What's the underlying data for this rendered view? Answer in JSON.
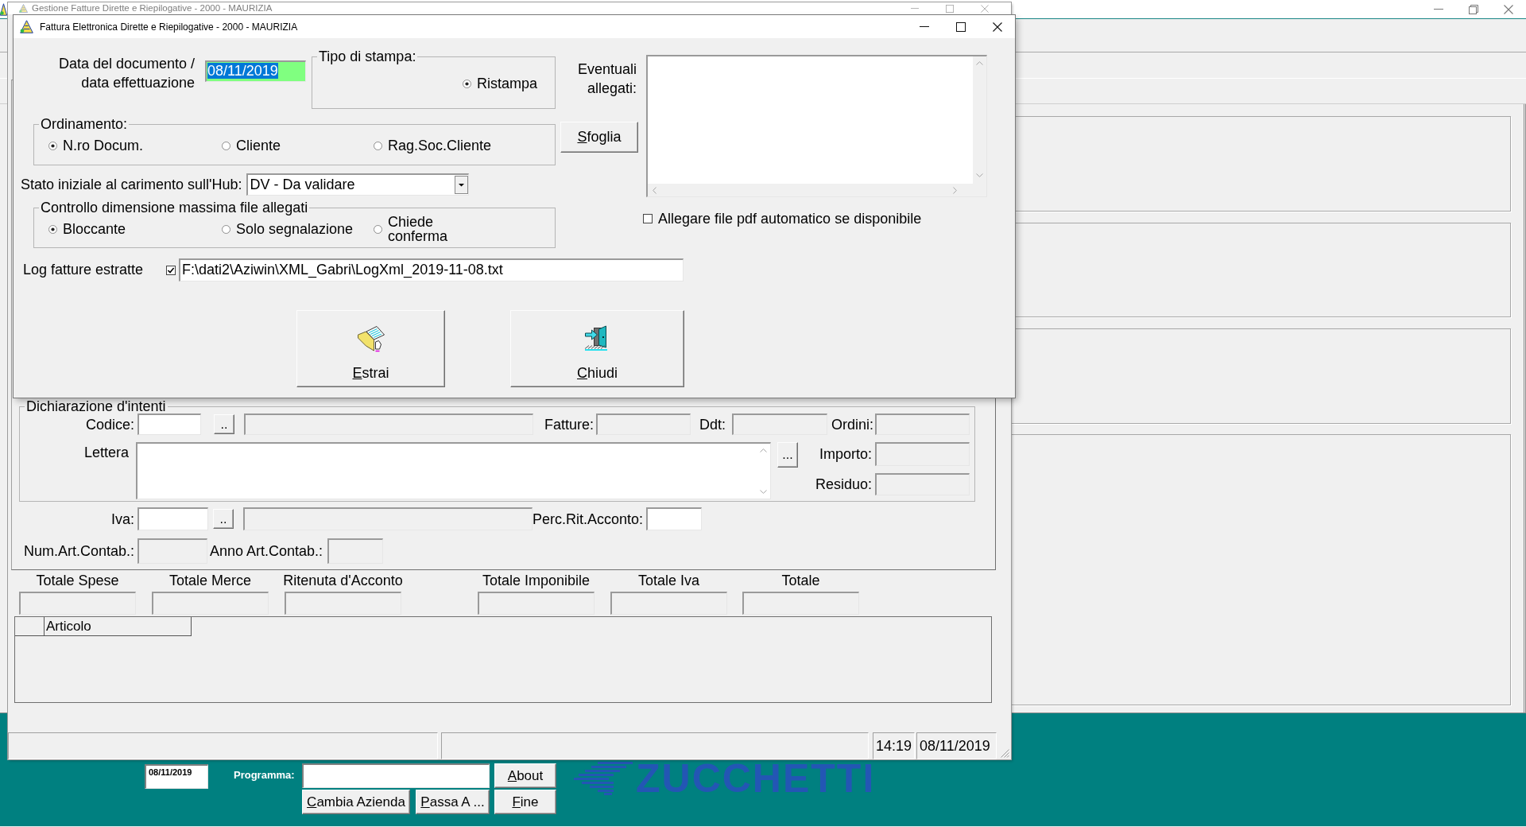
{
  "background_window": {
    "title": "Gestione Fatture Dirette e Riepilogative - 2000 - MAURIZIA"
  },
  "dialog": {
    "title": "Fattura Elettronica Dirette e Riepilogative - 2000 - MAURIZIA",
    "document_date": {
      "label": "Data del documento / data effettuazione",
      "value": "08/11/2019",
      "focused": true
    },
    "print_type": {
      "title": "Tipo di stampa:",
      "options": [
        {
          "label": "Ristampa",
          "selected": true
        }
      ]
    },
    "attachments": {
      "label": "Eventuali allegati:",
      "browse_button": "Sfoglia",
      "auto_pdf": {
        "label": "Allegare file pdf automatico se disponibile",
        "checked": false
      }
    },
    "sort_order": {
      "title": "Ordinamento:",
      "options": [
        {
          "label": "N.ro Docum.",
          "selected": true
        },
        {
          "label": "Cliente",
          "selected": false
        },
        {
          "label": "Rag.Soc.Cliente",
          "selected": false
        }
      ]
    },
    "hub_status": {
      "label": "Stato iniziale al carimento sull'Hub:",
      "value": "DV - Da validare"
    },
    "size_check": {
      "title": "Controllo dimensione massima file allegati",
      "options": [
        {
          "label": "Bloccante",
          "selected": true
        },
        {
          "label": "Solo segnalazione",
          "selected": false
        },
        {
          "label": "Chiede conferma",
          "selected": false
        }
      ]
    },
    "log": {
      "label": "Log fatture estratte",
      "checked": true,
      "value": "F:\\dati2\\Aziwin\\XML_Gabri\\LogXml_2019-11-08.txt"
    },
    "buttons": [
      {
        "label": "Estrai",
        "kind": "extract"
      },
      {
        "label": "Chiudi",
        "kind": "exit"
      }
    ]
  },
  "background_form": {
    "intent_declaration": {
      "title": "Dichiarazione d'intenti",
      "code": {
        "label": "Codice:",
        "disabled": false
      },
      "code_lookup": "..",
      "code_description": {
        "disabled": true
      },
      "invoices": {
        "label": "Fatture:",
        "disabled": true
      },
      "ddt": {
        "label": "Ddt:",
        "disabled": true
      },
      "orders": {
        "label": "Ordini:",
        "disabled": true
      },
      "letter": {
        "label": "Lettera",
        "disabled": false
      },
      "letter_button": "...",
      "amount": {
        "label": "Importo:",
        "disabled": true
      },
      "remaining": {
        "label": "Residuo:",
        "disabled": true
      }
    },
    "vat": {
      "label": "Iva:",
      "disabled": false
    },
    "vat_lookup": "..",
    "vat_description": {
      "disabled": true
    },
    "withholding_rate": {
      "label": "Perc.Rit.Acconto:",
      "disabled": false
    },
    "entry_number": {
      "label": "Num.Art.Contab.:",
      "disabled": true
    },
    "entry_year": {
      "label": "Anno Art.Contab.:",
      "disabled": true
    },
    "totals": [
      {
        "label": "Totale Spese",
        "disabled": true
      },
      {
        "label": "Totale Merce",
        "disabled": true
      },
      {
        "label": "Ritenuta d'Acconto",
        "disabled": true
      },
      {
        "label": "Totale Imponibile",
        "disabled": true
      },
      {
        "label": "Totale Iva",
        "disabled": true
      },
      {
        "label": "Totale",
        "disabled": true
      }
    ],
    "grid": {
      "columns": [
        "Articolo"
      ]
    },
    "status_bar": {
      "time": "14:19",
      "date": "08/11/2019"
    }
  },
  "main_window": {
    "launcher": {
      "date": "08/11/2019",
      "program_label": "Programma:",
      "buttons": [
        {
          "label": "About"
        },
        {
          "label": "Cambia Azienda"
        },
        {
          "label": "Passa A ..."
        },
        {
          "label": "Fine"
        }
      ]
    },
    "logo": "ZUCCHETTI"
  }
}
